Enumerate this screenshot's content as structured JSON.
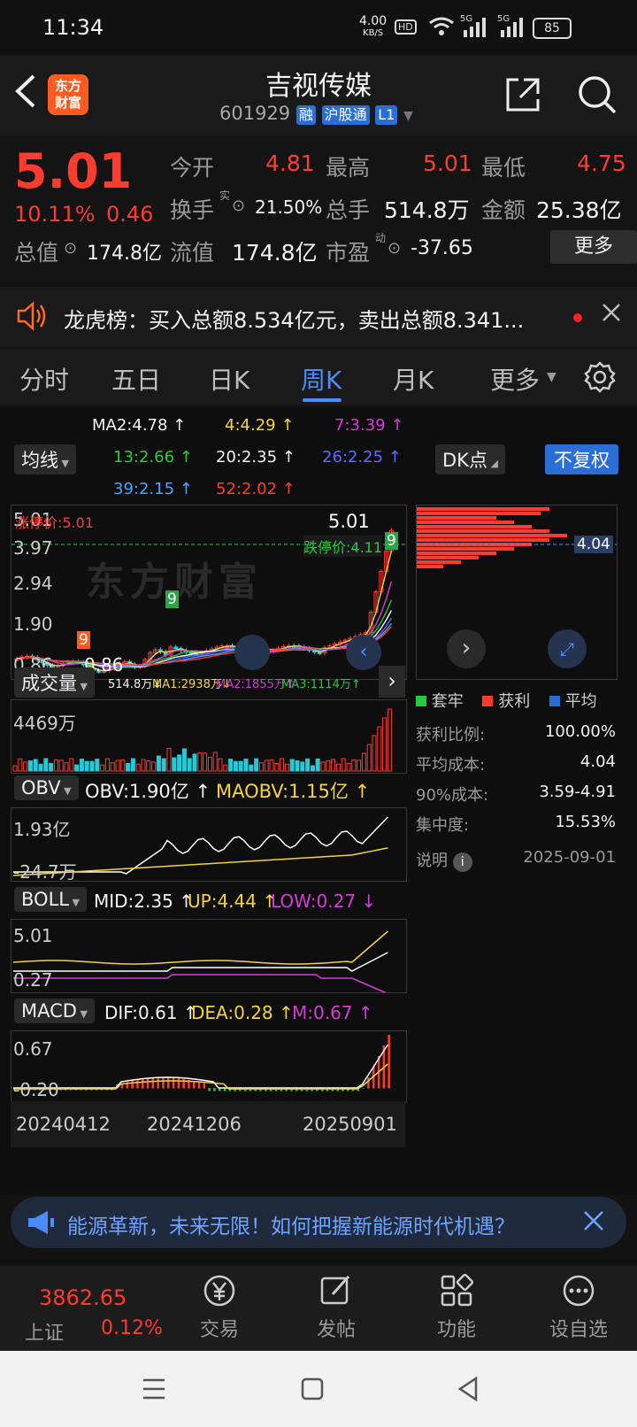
{
  "status": {
    "time": "11:34",
    "net_speed": "4.00",
    "net_unit": "KB/S",
    "hd": "HD",
    "sig1": "5G",
    "sig2": "5G",
    "battery": "85"
  },
  "header": {
    "logo": "东方\n财富",
    "title": "吉视传媒",
    "code": "601929",
    "tags": [
      "融",
      "沪股通",
      "L1"
    ]
  },
  "quote": {
    "price": "5.01",
    "pct": "10.11%",
    "chg": "0.46",
    "open_label": "今开",
    "open": "4.81",
    "high_label": "最高",
    "high": "5.01",
    "low_label": "最低",
    "low": "4.75",
    "turnover_label": "换手",
    "turnover_sup": "实",
    "turnover": "21.50%",
    "vol_label": "总手",
    "vol": "514.8万",
    "amount_label": "金额",
    "amount": "25.38亿",
    "mktcap_label": "总值",
    "mktcap": "174.8亿",
    "float_label": "流值",
    "float": "174.8亿",
    "pe_label": "市盈",
    "pe_sup": "动",
    "pe": "-37.65",
    "more": "更多"
  },
  "notice": {
    "text": "龙虎榜：买入总额8.534亿元，卖出总额8.341..."
  },
  "tabs": {
    "items": [
      "分时",
      "五日",
      "日K",
      "周K",
      "月K",
      "更多"
    ],
    "active": "周K"
  },
  "ma": {
    "dropdown": "均线",
    "dk": "DK点",
    "fq": "不复权",
    "row1": [
      "MA2:4.78 ↑",
      "4:4.29 ↑",
      "7:3.39 ↑"
    ],
    "row2": [
      "13:2.66 ↑",
      "20:2.35 ↑",
      "26:2.25 ↑"
    ],
    "row3": [
      "39:2.15 ↑",
      "52:2.02 ↑"
    ]
  },
  "kline": {
    "y_labels": [
      "5.01",
      "3.97",
      "2.94",
      "1.90",
      "0.86"
    ],
    "limit_up": "涨停价:5.01",
    "limit_down": "跌停价:4.11",
    "last": "5.01",
    "low_mark": "0.86",
    "watermark": "东方财富",
    "nine": "9"
  },
  "volume": {
    "dropdown": "成交量",
    "v": "514.8万↓",
    "ma1": "MA1:2938万↓",
    "ma2": "MA2:1855万↑",
    "ma3": "MA3:1114万↑",
    "ymax": "4469万"
  },
  "obv": {
    "dropdown": "OBV",
    "obv": "OBV:1.90亿 ↑",
    "maobv": "MAOBV:1.15亿 ↑",
    "ymax": "1.93亿",
    "ymin": "-24.7万"
  },
  "boll": {
    "dropdown": "BOLL",
    "mid": "MID:2.35 ↑",
    "up": "UP:4.44 ↑",
    "low": "LOW:0.27 ↓",
    "ymax": "5.01",
    "ymin": "0.27"
  },
  "macd": {
    "dropdown": "MACD",
    "dif": "DIF:0.61 ↑",
    "dea": "DEA:0.28 ↑",
    "m": "M:0.67 ↑",
    "ymax": "0.67",
    "ymin": "-0.20"
  },
  "dates": [
    "20240412",
    "20241206",
    "20250901"
  ],
  "chip": {
    "avg_price": "4.04",
    "legend": [
      "套牢",
      "获利",
      "平均"
    ],
    "rows": [
      [
        "获利比例:",
        "100.00%"
      ],
      [
        "平均成本:",
        "4.04"
      ],
      [
        "90%成本:",
        "3.59-4.91"
      ],
      [
        "集中度:",
        "15.53%"
      ]
    ],
    "note": "说明",
    "date": "2025-09-01"
  },
  "ad": {
    "text": "能源革新，未来无限！如何把握新能源时代机遇？"
  },
  "bottom": {
    "index_value": "3862.65",
    "index_name": "上证",
    "index_pct": "0.12%",
    "items": [
      "交易",
      "发帖",
      "功能",
      "设自选"
    ]
  },
  "colors": {
    "up": "#ff3b30",
    "down": "#27c93f",
    "accent": "#2b6fd6",
    "ma2": "#ffffff",
    "ma4": "#f5d33a",
    "ma7": "#d63bd6",
    "ma13": "#27c93f",
    "ma20": "#ffffff",
    "ma26": "#5a6cff",
    "ma39": "#4aa3ff",
    "ma52": "#ff3b30"
  }
}
